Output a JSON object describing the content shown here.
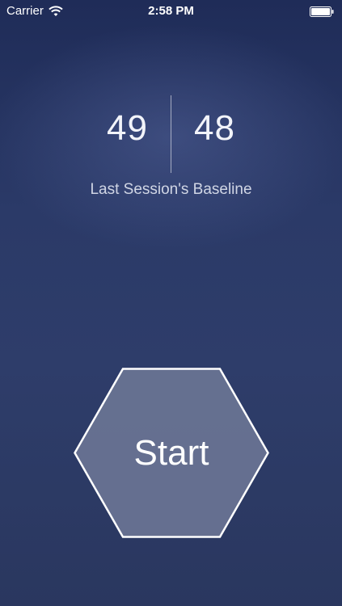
{
  "status_bar": {
    "carrier": "Carrier",
    "time": "2:58 PM",
    "wifi_icon": "wifi-icon",
    "battery_icon": "battery-icon",
    "battery_level": 1.0
  },
  "baseline": {
    "left_value": "49",
    "right_value": "48",
    "label": "Last Session's Baseline"
  },
  "start_button": {
    "label": "Start",
    "shape": "hexagon"
  },
  "colors": {
    "background_top": "#1f2c58",
    "background_bottom": "#2a375f",
    "hexagon_fill": "#6b7695",
    "hexagon_stroke": "#ffffff",
    "text": "#ffffff"
  }
}
